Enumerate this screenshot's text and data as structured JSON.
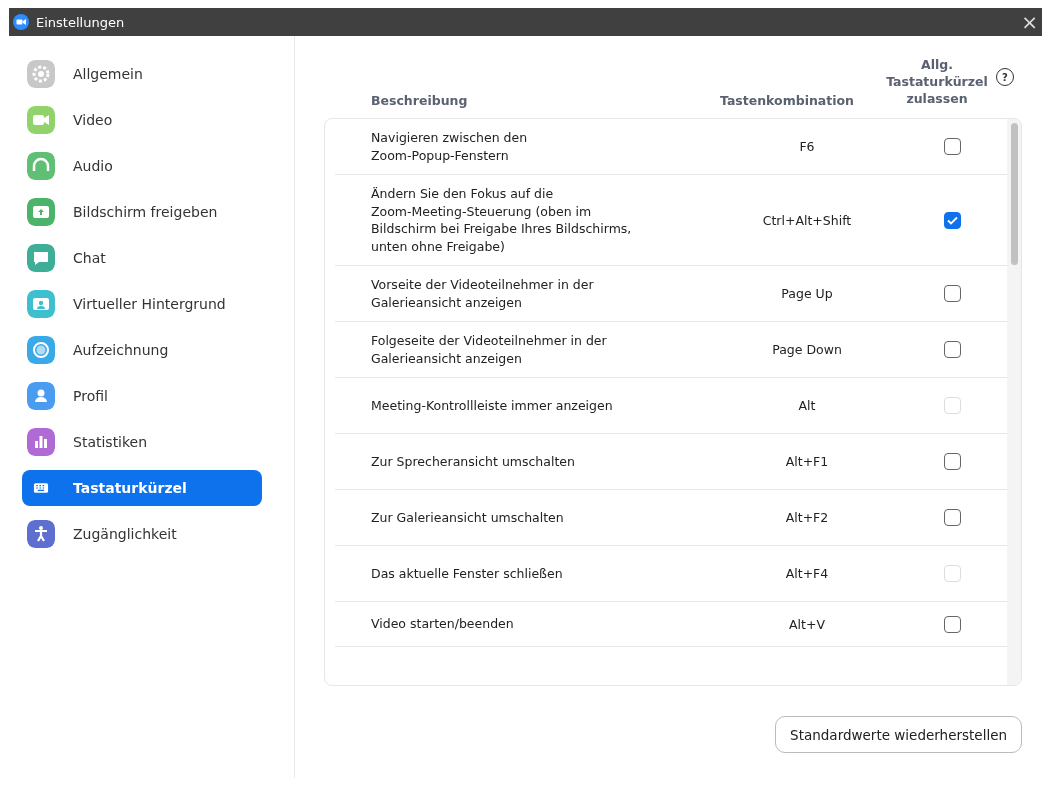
{
  "window": {
    "title": "Einstellungen",
    "close": "×"
  },
  "sidebar": {
    "items": [
      {
        "label": "Allgemein",
        "color": "#c8c8c8",
        "selected": false
      },
      {
        "label": "Video",
        "color": "#8fd36a",
        "selected": false
      },
      {
        "label": "Audio",
        "color": "#5fbf74",
        "selected": false
      },
      {
        "label": "Bildschirm freigeben",
        "color": "#4cb46a",
        "selected": false
      },
      {
        "label": "Chat",
        "color": "#3fae98",
        "selected": false
      },
      {
        "label": "Virtueller Hintergrund",
        "color": "#3dbfd0",
        "selected": false
      },
      {
        "label": "Aufzeichnung",
        "color": "#3aa9e8",
        "selected": false
      },
      {
        "label": "Profil",
        "color": "#4a9cf0",
        "selected": false
      },
      {
        "label": "Statistiken",
        "color": "#b06ad6",
        "selected": false
      },
      {
        "label": "Tastaturkürzel",
        "selected": true
      },
      {
        "label": "Zugänglichkeit",
        "color": "#5e6fd0",
        "selected": false
      }
    ]
  },
  "table": {
    "columns": [
      "Beschreibung",
      "Tastenkombination",
      "Allg. Tastaturkürzel zulassen"
    ],
    "help": "?",
    "rows": [
      {
        "description": "Navigieren zwischen den\nZoom-Popup-Fenstern",
        "shortcut": "F6",
        "checked": false,
        "disabled": false
      },
      {
        "description": "Ändern Sie den Fokus auf die\nZoom-Meeting-Steuerung (oben im\nBildschirm bei Freigabe Ihres Bildschirms,\nunten ohne Freigabe)",
        "shortcut": "Ctrl+Alt+Shift",
        "checked": true,
        "disabled": false
      },
      {
        "description": "Vorseite der Videoteilnehmer in der\nGalerieansicht anzeigen",
        "shortcut": "Page Up",
        "checked": false,
        "disabled": false
      },
      {
        "description": "Folgeseite der Videoteilnehmer in der\nGalerieansicht anzeigen",
        "shortcut": "Page Down",
        "checked": false,
        "disabled": false
      },
      {
        "description": "Meeting-Kontrollleiste immer anzeigen",
        "shortcut": "Alt",
        "checked": false,
        "disabled": true
      },
      {
        "description": "Zur Sprecheransicht umschalten",
        "shortcut": "Alt+F1",
        "checked": false,
        "disabled": false
      },
      {
        "description": "Zur Galerieansicht umschalten",
        "shortcut": "Alt+F2",
        "checked": false,
        "disabled": false
      },
      {
        "description": "Das aktuelle Fenster schließen",
        "shortcut": "Alt+F4",
        "checked": false,
        "disabled": true
      },
      {
        "description": "Video starten/beenden",
        "shortcut": "Alt+V",
        "checked": false,
        "disabled": false
      }
    ]
  },
  "restore_button": "Standardwerte wiederherstellen"
}
